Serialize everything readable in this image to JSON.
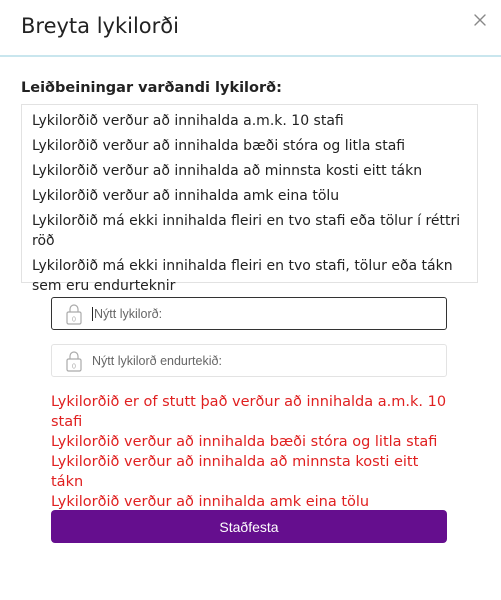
{
  "dialog": {
    "title": "Breyta lykilorði",
    "close_icon": "close-icon"
  },
  "guidelines": {
    "title": "Leiðbeiningar varðandi lykilorð:",
    "rules": [
      "Lykilorðið verður að innihalda a.m.k. 10 stafi",
      "Lykilorðið verður að innihalda bæði stóra og litla stafi",
      "Lykilorðið verður að innihalda að minnsta kosti eitt tákn",
      "Lykilorðið verður að innihalda amk eina tölu",
      "Lykilorðið má ekki innihalda fleiri en tvo stafi eða tölur í réttri röð",
      "Lykilorðið má ekki innihalda fleiri en tvo stafi, tölur eða tákn sem eru endurteknir"
    ]
  },
  "form": {
    "new_password": {
      "value": "",
      "placeholder": "Nýtt lykilorð:",
      "icon": "lock-icon",
      "focused": true
    },
    "repeat_password": {
      "value": "",
      "placeholder": "Nýtt lykilorð endurtekið:",
      "icon": "lock-icon"
    }
  },
  "errors": [
    "Lykilorðið er of stutt það verður að innihalda a.m.k. 10 stafi",
    "Lykilorðið verður að innihalda bæði stóra og litla stafi",
    "Lykilorðið verður að innihalda að minnsta kosti eitt tákn",
    "Lykilorðið verður að innihalda amk eina tölu"
  ],
  "confirm_button": {
    "label": "Staðfesta"
  },
  "colors": {
    "accent": "#650e8e",
    "error": "#e02020",
    "header_divider": "#c9e6ee"
  }
}
